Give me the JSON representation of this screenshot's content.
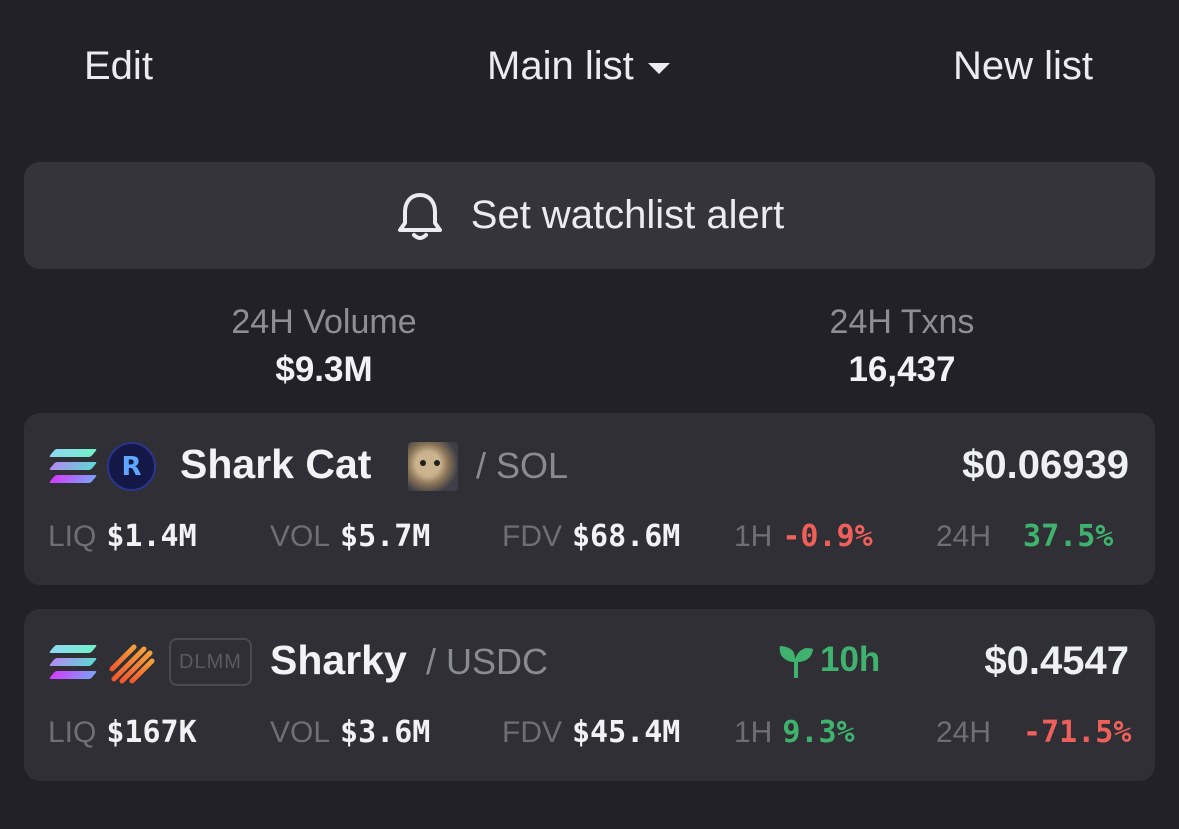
{
  "header": {
    "edit_label": "Edit",
    "list_selector_label": "Main list",
    "new_list_label": "New list"
  },
  "alert_button": {
    "label": "Set watchlist alert",
    "icon": "bell-icon"
  },
  "stats": {
    "volume_label": "24H Volume",
    "volume_value": "$9.3M",
    "txns_label": "24H Txns",
    "txns_value": "16,437"
  },
  "pairs": [
    {
      "chain_icon": "solana-icon",
      "dex_icon": "raydium-icon",
      "name": "Shark Cat",
      "quote": "/ SOL",
      "price": "$0.06939",
      "liq_label": "LIQ",
      "liq": "$1.4M",
      "vol_label": "VOL",
      "vol": "$5.7M",
      "fdv_label": "FDV",
      "fdv": "$68.6M",
      "h1_label": "1H",
      "h1": "-0.9%",
      "h24_label": "24H",
      "h24": "37.5%",
      "colors": {
        "h1": "#f0605a",
        "h24": "#3fb36d"
      }
    },
    {
      "chain_icon": "solana-icon",
      "dex_icon": "meteora-icon",
      "badge": "DLMM",
      "name": "Sharky",
      "quote": "/ USDC",
      "age": "10h",
      "age_icon": "sprout-icon",
      "price": "$0.4547",
      "liq_label": "LIQ",
      "liq": "$167K",
      "vol_label": "VOL",
      "vol": "$3.6M",
      "fdv_label": "FDV",
      "fdv": "$45.4M",
      "h1_label": "1H",
      "h1": "9.3%",
      "h24_label": "24H",
      "h24": "-71.5%",
      "colors": {
        "h1": "#3fb36d",
        "h24": "#f0605a"
      }
    }
  ],
  "theme": {
    "background": "#222127",
    "card": "#2f2f35",
    "positive": "#3fb36d",
    "negative": "#f0605a"
  }
}
